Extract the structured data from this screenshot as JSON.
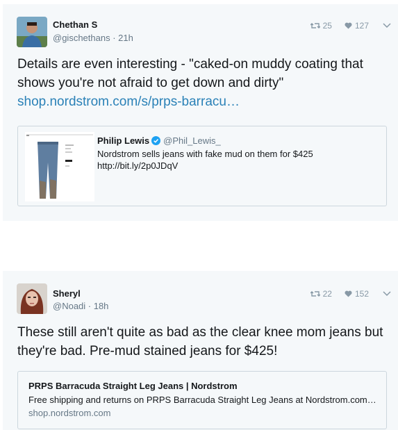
{
  "tweet1": {
    "name": "Chethan S",
    "handle_time": "@gischethans · 21h",
    "retweets": "25",
    "likes": "127",
    "text": "Details are even interesting - \"caked-on muddy coating that shows you're not afraid to get down and dirty\"",
    "link": "shop.nordstrom.com/s/prps-barracu…",
    "quote": {
      "name": "Philip Lewis",
      "handle": "@Phil_Lewis_",
      "text_line1": "Nordstrom sells jeans with fake mud on them for $425",
      "text_line2": "http://bit.ly/2p0JDqV"
    }
  },
  "tweet2": {
    "name": "Sheryl",
    "handle_time": "@Noadi · 18h",
    "retweets": "22",
    "likes": "152",
    "text": "These still aren't quite as bad as the clear knee mom jeans but they're bad. Pre-mud stained jeans for $425!",
    "card": {
      "title": "PRPS Barracuda Straight Leg Jeans | Nordstrom",
      "description": "Free shipping and returns on PRPS Barracuda Straight Leg Jeans at Nordstrom.com…",
      "domain": "shop.nordstrom.com"
    }
  },
  "colors": {
    "background": "#f5f8fa",
    "link": "#2a81b7",
    "muted": "#8899a6",
    "verified": "#1da1f2"
  }
}
